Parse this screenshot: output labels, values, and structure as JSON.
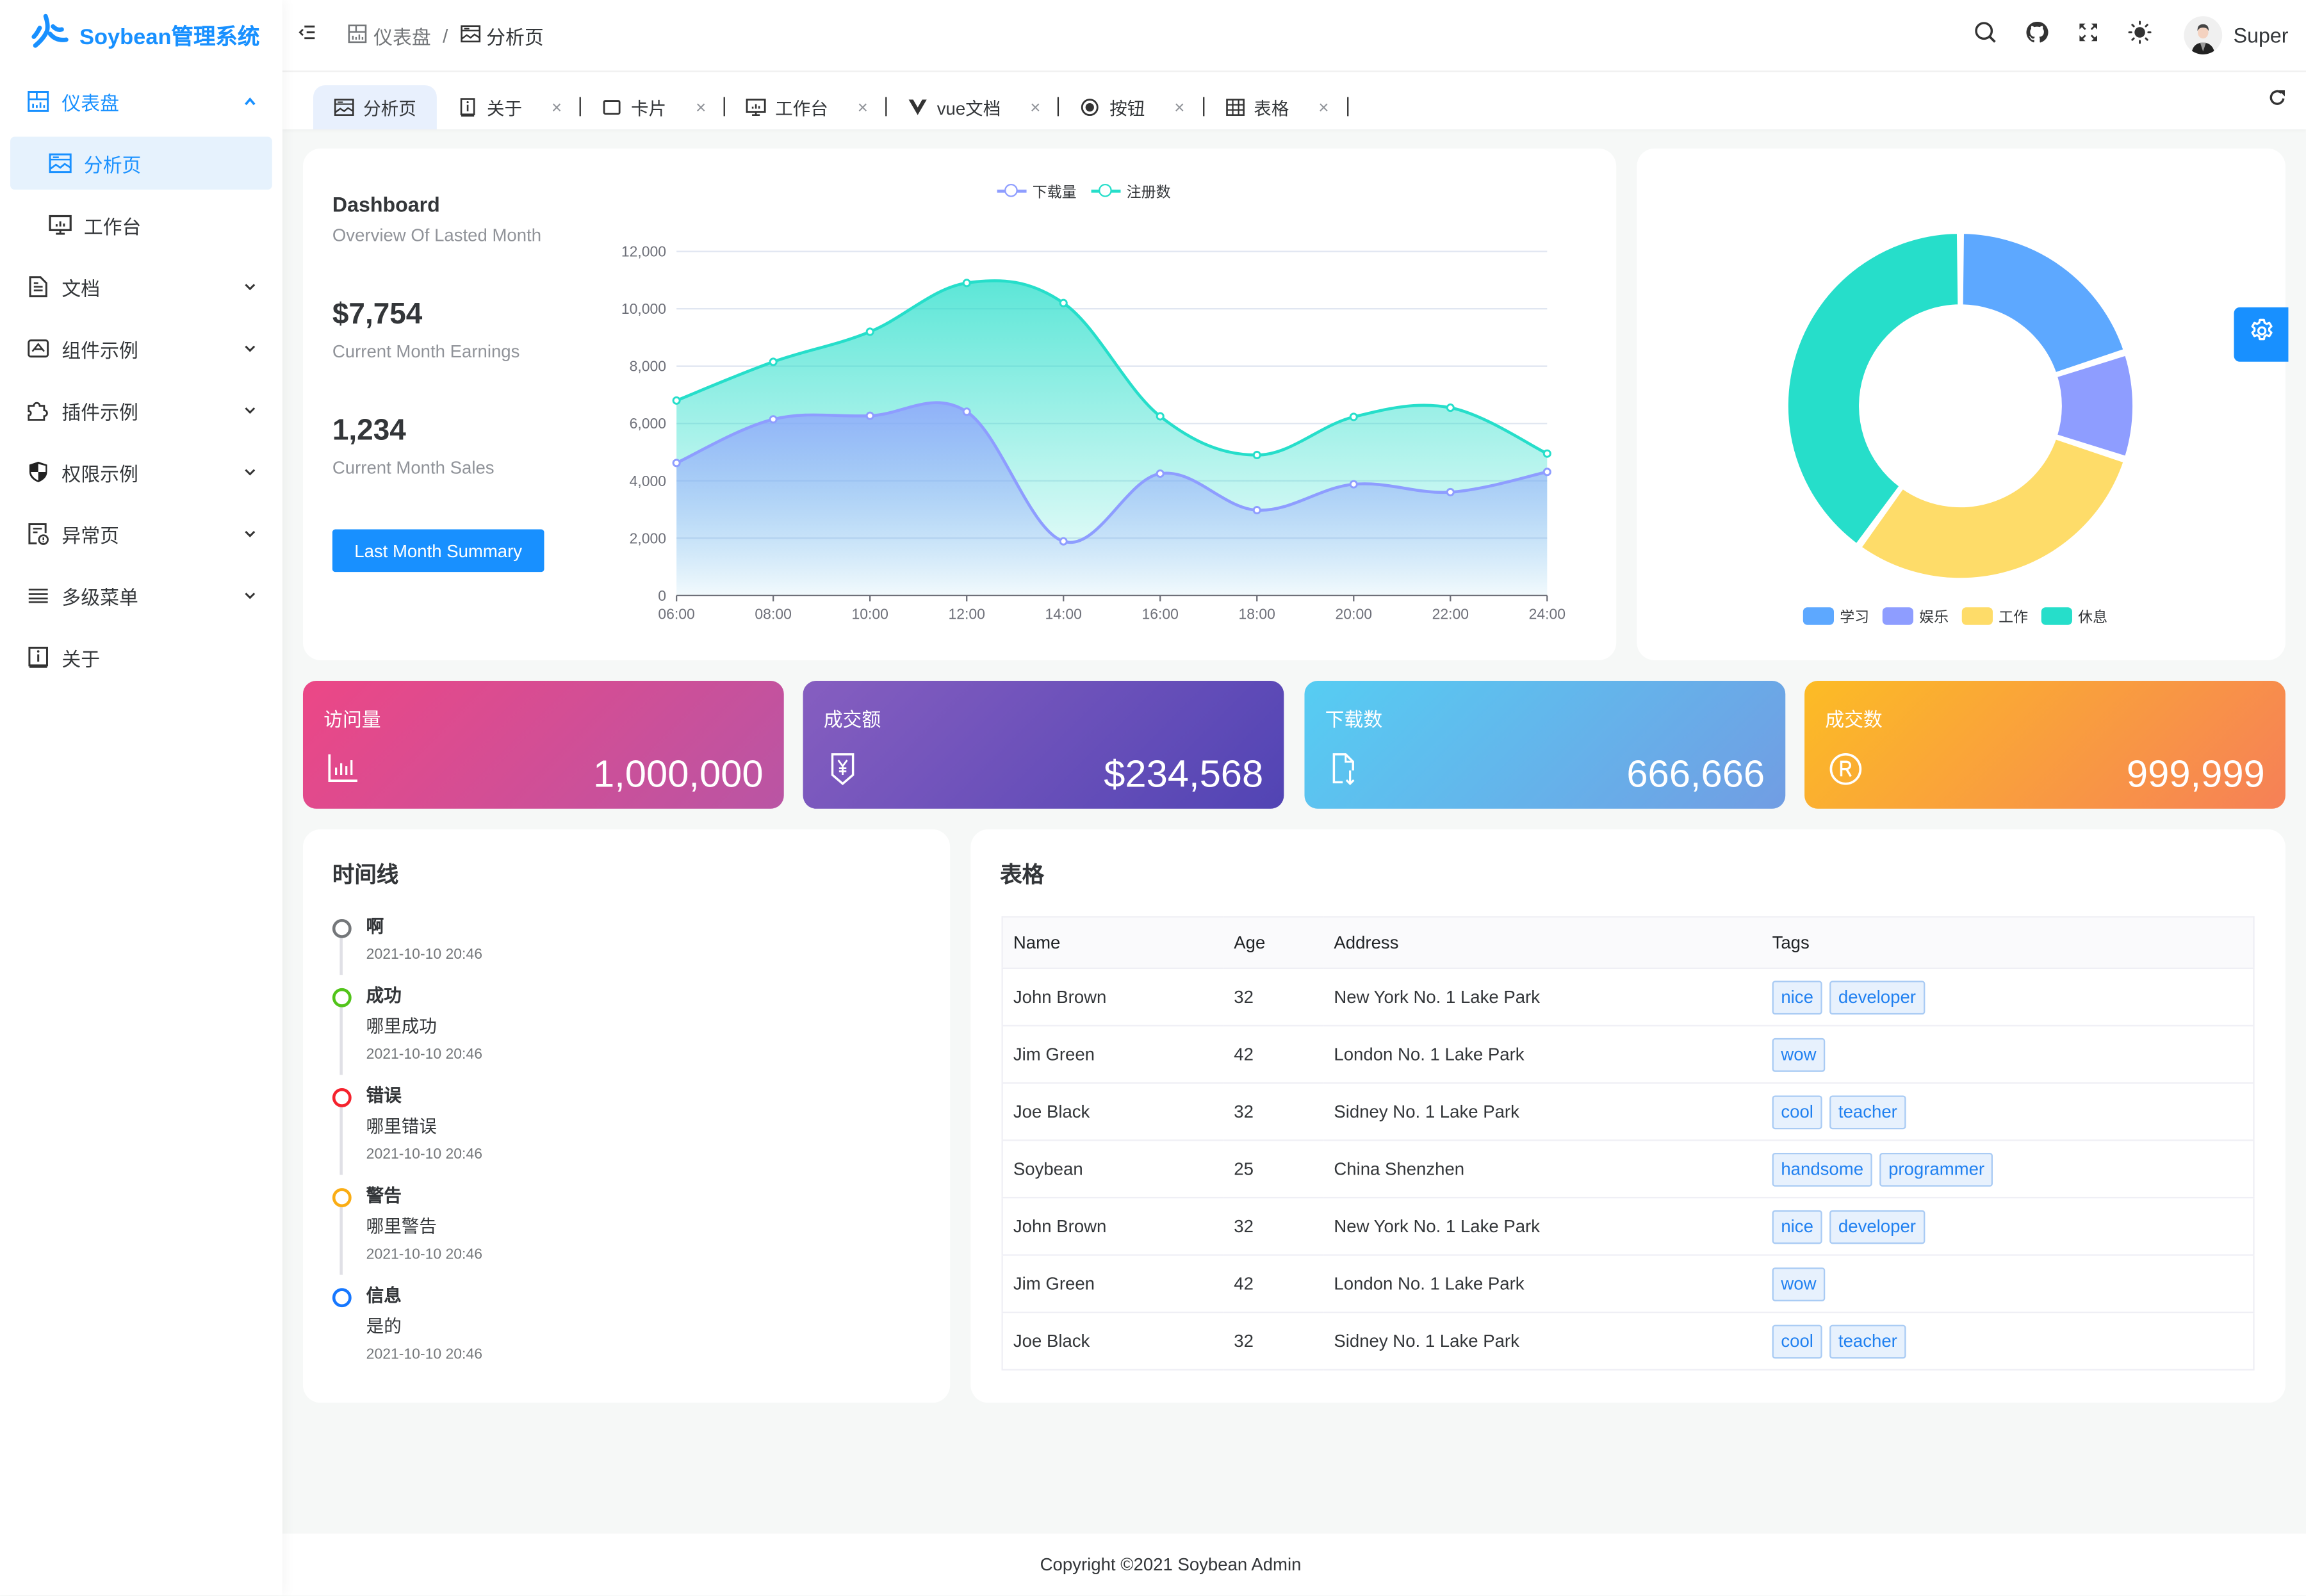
{
  "app": {
    "logo_text": "Soybean管理系统",
    "brand_color": "#1890ff"
  },
  "sidebar": {
    "items": [
      {
        "label": "仪表盘",
        "icon": "dashboard-icon",
        "expanded": true,
        "active_parent": true
      },
      {
        "label": "分析页",
        "icon": "analysis-icon",
        "sub": true,
        "active": true
      },
      {
        "label": "工作台",
        "icon": "workbench-icon",
        "sub": true
      },
      {
        "label": "文档",
        "icon": "document-icon",
        "expandable": true
      },
      {
        "label": "组件示例",
        "icon": "component-icon",
        "expandable": true
      },
      {
        "label": "插件示例",
        "icon": "plugin-icon",
        "expandable": true
      },
      {
        "label": "权限示例",
        "icon": "shield-icon",
        "expandable": true
      },
      {
        "label": "异常页",
        "icon": "exception-icon",
        "expandable": true
      },
      {
        "label": "多级菜单",
        "icon": "menu-lines-icon",
        "expandable": true
      },
      {
        "label": "关于",
        "icon": "info-icon"
      }
    ]
  },
  "header": {
    "breadcrumb": [
      {
        "label": "仪表盘",
        "icon": "dashboard-icon"
      },
      {
        "label": "分析页",
        "icon": "analysis-icon"
      }
    ],
    "separator": "/",
    "user_name": "Super",
    "actions": [
      "search-icon",
      "github-icon",
      "fullscreen-icon",
      "theme-sun-icon"
    ]
  },
  "tabs": [
    {
      "label": "分析页",
      "icon": "analysis-icon",
      "active": true,
      "closable": false
    },
    {
      "label": "关于",
      "icon": "info-icon",
      "closable": true
    },
    {
      "label": "卡片",
      "icon": "card-icon",
      "closable": true
    },
    {
      "label": "工作台",
      "icon": "workbench-icon",
      "closable": true
    },
    {
      "label": "vue文档",
      "icon": "vue-icon",
      "closable": true
    },
    {
      "label": "按钮",
      "icon": "button-icon",
      "closable": true
    },
    {
      "label": "表格",
      "icon": "table-icon",
      "closable": true
    }
  ],
  "tab_close_glyph": "×",
  "dashboard": {
    "title": "Dashboard",
    "subtitle": "Overview Of Lasted Month",
    "earnings": "$7,754",
    "earnings_label": "Current Month Earnings",
    "sales": "1,234",
    "sales_label": "Current Month Sales",
    "summary_button": "Last Month Summary"
  },
  "chart_data": [
    {
      "type": "area",
      "title": "",
      "x": [
        "06:00",
        "08:00",
        "10:00",
        "12:00",
        "14:00",
        "16:00",
        "18:00",
        "20:00",
        "22:00",
        "24:00"
      ],
      "series": [
        {
          "name": "下载量",
          "color": "#8e9dff",
          "values": [
            4623,
            6145,
            6268,
            6411,
            1890,
            4251,
            2978,
            3880,
            3606,
            4311
          ]
        },
        {
          "name": "注册数",
          "color": "#26deca",
          "values": [
            6800,
            8150,
            9200,
            10900,
            10200,
            6250,
            4900,
            6230,
            6550,
            4950
          ]
        }
      ],
      "ylim": [
        0,
        12000
      ],
      "yticks": [
        0,
        2000,
        4000,
        6000,
        8000,
        10000,
        12000
      ],
      "ytick_labels": [
        "0",
        "2,000",
        "4,000",
        "6,000",
        "8,000",
        "10,000",
        "12,000"
      ],
      "smooth": true,
      "grid": true,
      "legend": "top-center",
      "xlabel": "",
      "ylabel": ""
    },
    {
      "type": "pie",
      "donut": true,
      "categories": [
        "学习",
        "娱乐",
        "工作",
        "休息"
      ],
      "values": [
        20,
        10,
        30,
        40
      ],
      "colors": [
        "#5da8ff",
        "#8e9dff",
        "#fedc69",
        "#26deca"
      ],
      "legend": "bottom-center"
    }
  ],
  "stats": [
    {
      "title": "访问量",
      "value": "1,000,000",
      "icon": "bar-chart-icon",
      "from": "#ec4786",
      "to": "#b955a4"
    },
    {
      "title": "成交额",
      "value": "$234,568",
      "icon": "yen-tag-icon",
      "from": "#865ec0",
      "to": "#5144b4"
    },
    {
      "title": "下载数",
      "value": "666,666",
      "icon": "file-download-icon",
      "from": "#56cdf3",
      "to": "#719de3"
    },
    {
      "title": "成交数",
      "value": "999,999",
      "icon": "registered-icon",
      "from": "#fcbc25",
      "to": "#f68057"
    }
  ],
  "timeline": {
    "title": "时间线",
    "items": [
      {
        "title": "啊",
        "content": "",
        "time": "2021-10-10 20:46",
        "color": "#74777a"
      },
      {
        "title": "成功",
        "content": "哪里成功",
        "time": "2021-10-10 20:46",
        "color": "#52c41a"
      },
      {
        "title": "错误",
        "content": "哪里错误",
        "time": "2021-10-10 20:46",
        "color": "#f5222d"
      },
      {
        "title": "警告",
        "content": "哪里警告",
        "time": "2021-10-10 20:46",
        "color": "#faad14"
      },
      {
        "title": "信息",
        "content": "是的",
        "time": "2021-10-10 20:46",
        "color": "#1677ff"
      }
    ]
  },
  "table": {
    "title": "表格",
    "columns": [
      "Name",
      "Age",
      "Address",
      "Tags"
    ],
    "rows": [
      {
        "name": "John Brown",
        "age": "32",
        "address": "New York No. 1 Lake Park",
        "tags": [
          "nice",
          "developer"
        ]
      },
      {
        "name": "Jim Green",
        "age": "42",
        "address": "London No. 1 Lake Park",
        "tags": [
          "wow"
        ]
      },
      {
        "name": "Joe Black",
        "age": "32",
        "address": "Sidney No. 1 Lake Park",
        "tags": [
          "cool",
          "teacher"
        ]
      },
      {
        "name": "Soybean",
        "age": "25",
        "address": "China Shenzhen",
        "tags": [
          "handsome",
          "programmer"
        ]
      },
      {
        "name": "John Brown",
        "age": "32",
        "address": "New York No. 1 Lake Park",
        "tags": [
          "nice",
          "developer"
        ]
      },
      {
        "name": "Jim Green",
        "age": "42",
        "address": "London No. 1 Lake Park",
        "tags": [
          "wow"
        ]
      },
      {
        "name": "Joe Black",
        "age": "32",
        "address": "Sidney No. 1 Lake Park",
        "tags": [
          "cool",
          "teacher"
        ]
      }
    ]
  },
  "footer": {
    "copyright": "Copyright ©2021 Soybean Admin"
  }
}
